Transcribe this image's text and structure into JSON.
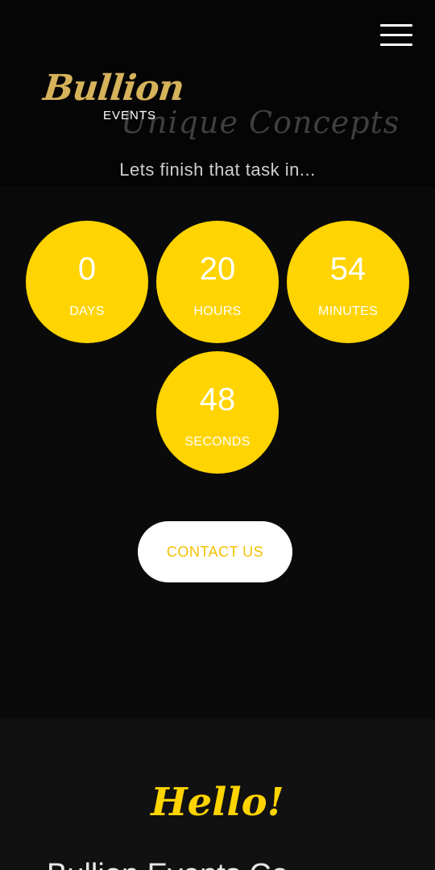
{
  "header": {
    "menu_icon": "hamburger-menu-icon"
  },
  "brand": {
    "logo_script": "Bullion",
    "logo_sub": "EVENTS",
    "tagline": "Unique Concepts"
  },
  "countdown": {
    "intro": "Lets finish that task in...",
    "days": {
      "value": "0",
      "label": "DAYS"
    },
    "hours": {
      "value": "20",
      "label": "HOURS"
    },
    "minutes": {
      "value": "54",
      "label": "MINUTES"
    },
    "seconds": {
      "value": "48",
      "label": "SECONDS"
    },
    "circle_color": "#ffd400"
  },
  "cta": {
    "contact_label": "CONTACT US"
  },
  "section_two": {
    "greeting": "Hello!",
    "heading_partial": "Bullion Events Co"
  },
  "colors": {
    "background": "#0a0a0a",
    "accent": "#ffd400",
    "logo_gold": "#d6b25a"
  }
}
